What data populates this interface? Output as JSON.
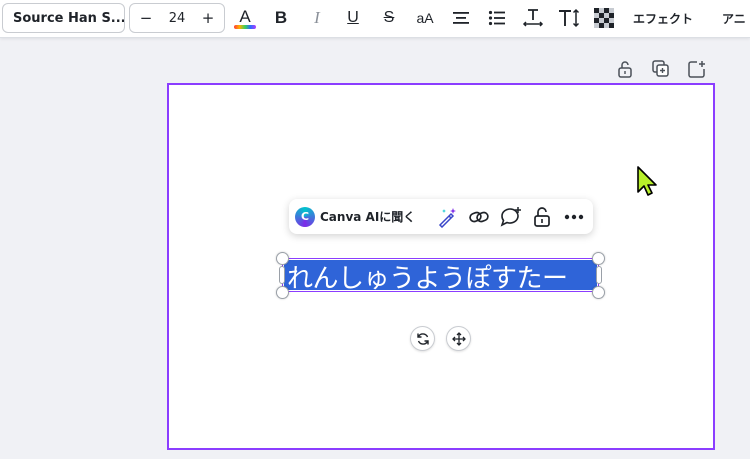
{
  "toolbar": {
    "font_family": "Source Han S...",
    "font_size": {
      "decrease_label": "−",
      "value": "24",
      "increase_label": "+"
    },
    "text_color_label": "A",
    "text_color_swatch": "#e33",
    "bold_label": "B",
    "italic_label": "I",
    "underline_label": "U",
    "strikethrough_label": "S",
    "case_label": "aA",
    "effects_label": "エフェクト",
    "animate_label": "アニ"
  },
  "page_actions": [
    "lock-icon",
    "duplicate-page-icon",
    "add-page-icon"
  ],
  "context_bar": {
    "ai_label": "Canva AIに聞く",
    "ai_logo_letter": "C",
    "icons": [
      "magic-edit-icon",
      "link-icon",
      "comment-icon",
      "lock-icon",
      "more-icon"
    ]
  },
  "canvas": {
    "selected_text": "れんしゅうようぽすたー",
    "selection_color": "#2f64d8",
    "page_border_color": "#8b3dff"
  },
  "colors": {
    "accent": "#8b3dff",
    "cursor": "#b7ef2a"
  }
}
